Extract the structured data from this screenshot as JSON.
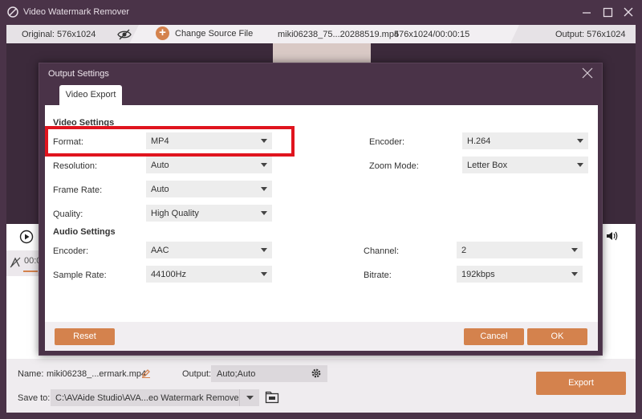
{
  "app": {
    "title": "Video Watermark Remover"
  },
  "infobar": {
    "original": "Original: 576x1024",
    "change_source": "Change Source File",
    "file_name": "miki06238_75...20288519.mp4",
    "file_meta": "576x1024/00:00:15",
    "output": "Output: 576x1024"
  },
  "timeline": {
    "time": "00:0"
  },
  "bottom": {
    "name_label": "Name:",
    "name_value": "miki06238_...ermark.mp4",
    "output_label": "Output:",
    "output_value": "Auto;Auto",
    "saveto_label": "Save to:",
    "saveto_value": "C:\\AVAide Studio\\AVA...eo Watermark Remover",
    "export_label": "Export"
  },
  "dialog": {
    "title": "Output Settings",
    "tab": "Video Export",
    "video_section": "Video Settings",
    "audio_section": "Audio Settings",
    "video": {
      "format_label": "Format:",
      "format_value": "MP4",
      "resolution_label": "Resolution:",
      "resolution_value": "Auto",
      "framerate_label": "Frame Rate:",
      "framerate_value": "Auto",
      "quality_label": "Quality:",
      "quality_value": "High Quality",
      "encoder_label": "Encoder:",
      "encoder_value": "H.264",
      "zoom_label": "Zoom Mode:",
      "zoom_value": "Letter Box"
    },
    "audio": {
      "encoder_label": "Encoder:",
      "encoder_value": "AAC",
      "samplerate_label": "Sample Rate:",
      "samplerate_value": "44100Hz",
      "channel_label": "Channel:",
      "channel_value": "2",
      "bitrate_label": "Bitrate:",
      "bitrate_value": "192kbps"
    },
    "buttons": {
      "reset": "Reset",
      "cancel": "Cancel",
      "ok": "OK"
    }
  },
  "colors": {
    "accent": "#d4824d",
    "chrome": "#4a3348",
    "highlight": "#e0141e"
  }
}
